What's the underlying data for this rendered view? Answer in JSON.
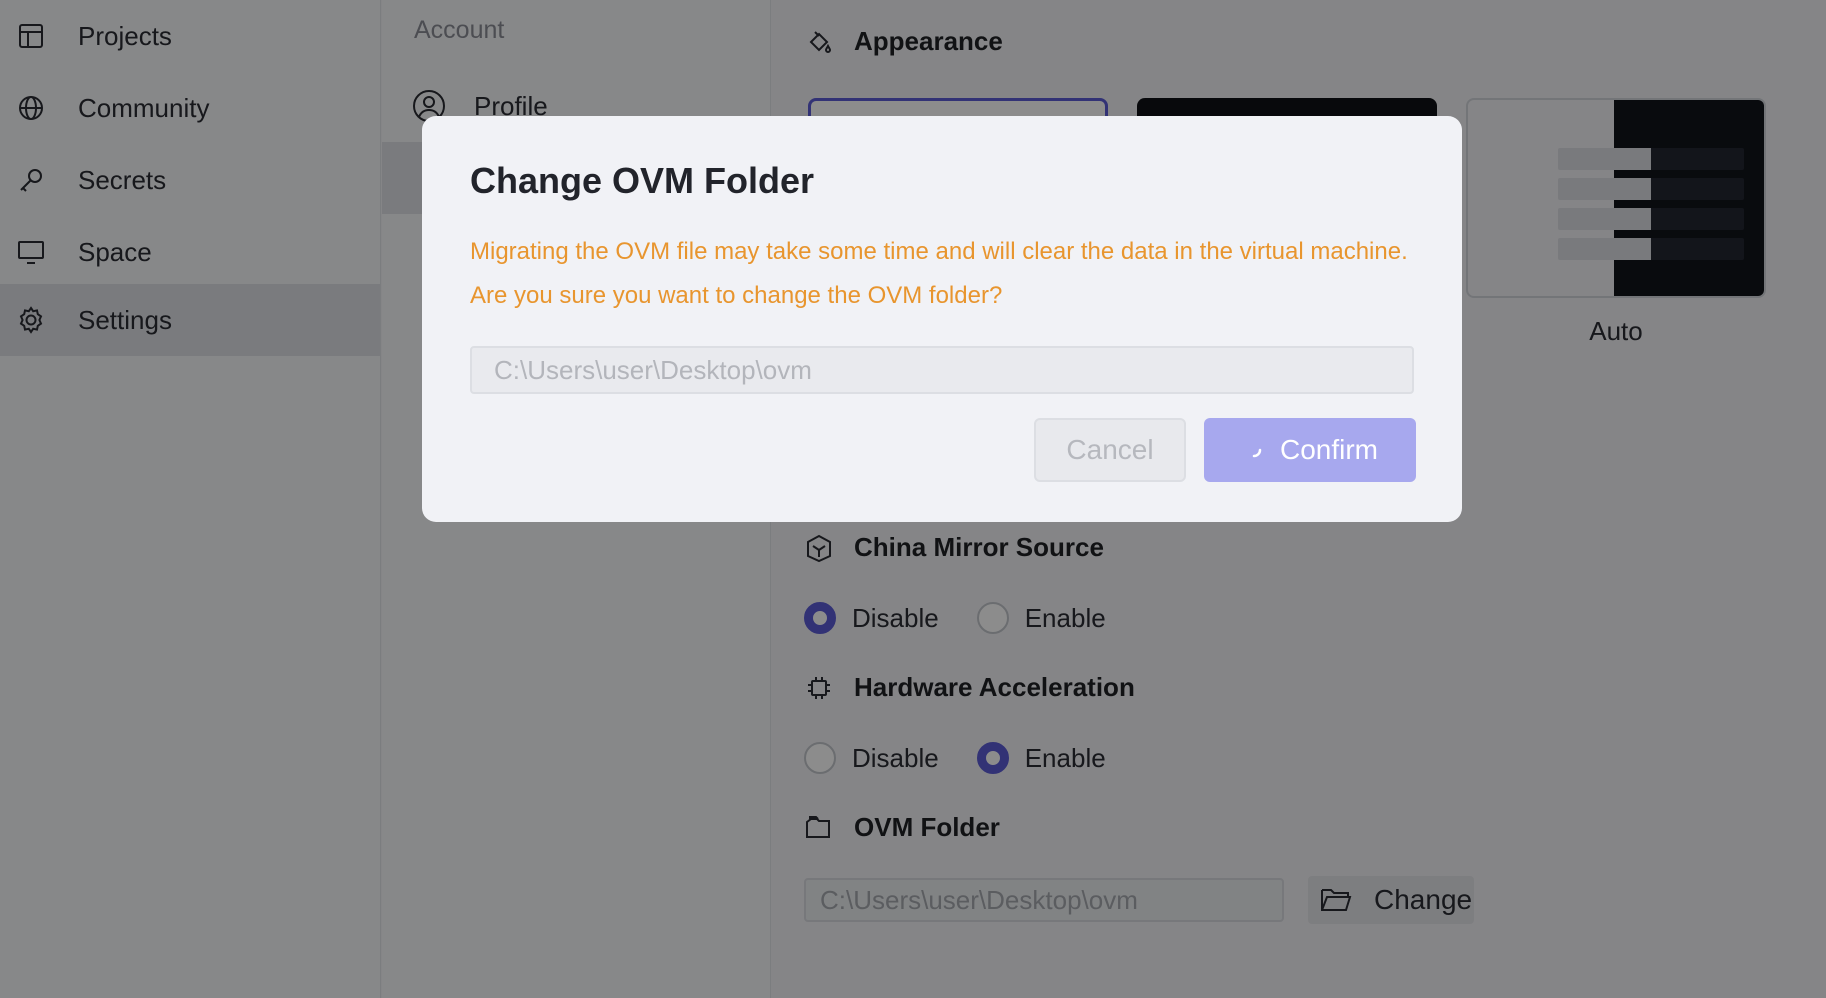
{
  "sidebar": {
    "items": [
      {
        "label": "Projects",
        "icon": "table-icon"
      },
      {
        "label": "Community",
        "icon": "globe-icon"
      },
      {
        "label": "Secrets",
        "icon": "key-icon"
      },
      {
        "label": "Space",
        "icon": "monitor-icon"
      },
      {
        "label": "Settings",
        "icon": "gear-icon",
        "active": true
      }
    ]
  },
  "subnav": {
    "section": "Account",
    "items": [
      {
        "label": "Profile",
        "icon": "user-circle-icon"
      }
    ]
  },
  "content": {
    "appearance": {
      "title": "Appearance",
      "auto_label": "Auto"
    },
    "china_mirror": {
      "title": "China Mirror Source",
      "options": [
        "Disable",
        "Enable"
      ],
      "selected": "Disable"
    },
    "hardware_accel": {
      "title": "Hardware Acceleration",
      "options": [
        "Disable",
        "Enable"
      ],
      "selected": "Enable"
    },
    "ovm_folder": {
      "title": "OVM Folder",
      "value": "C:\\Users\\user\\Desktop\\ovm",
      "change_label": "Change"
    }
  },
  "modal": {
    "title": "Change OVM Folder",
    "warning": "Migrating the OVM file may take some time and will clear the data in the virtual machine. Are you sure you want to change the OVM folder?",
    "input_value": "C:\\Users\\user\\Desktop\\ovm",
    "cancel_label": "Cancel",
    "confirm_label": "Confirm"
  },
  "colors": {
    "accent": "#5b5bd6",
    "warning": "#e8952e",
    "confirm_disabled": "#a7a8ee"
  }
}
